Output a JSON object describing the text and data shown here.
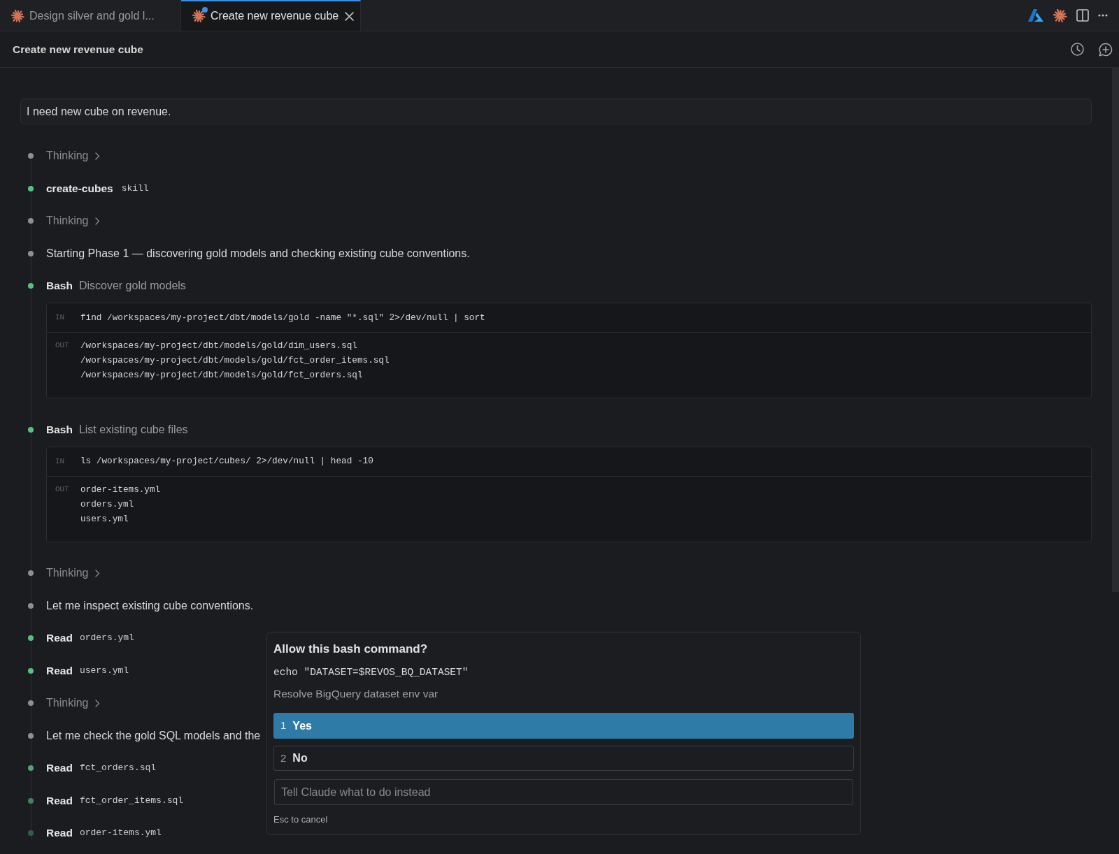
{
  "tabs": [
    {
      "title": "Design silver and gold l...",
      "selected": false,
      "notification": false
    },
    {
      "title": "Create new revenue cube",
      "selected": true,
      "notification": true
    }
  ],
  "header": {
    "title": "Create new revenue cube"
  },
  "user_message": "I need new cube on revenue.",
  "timeline": [
    {
      "kind": "thinking",
      "label": "Thinking",
      "expanded": false,
      "color": "#8e8f92"
    },
    {
      "kind": "skill",
      "name": "create-cubes",
      "tag": "skill",
      "color": "#55c283"
    },
    {
      "kind": "thinking",
      "label": "Thinking",
      "expanded": false,
      "color": "#8e8f92"
    },
    {
      "kind": "message",
      "text": "Starting Phase 1 — discovering gold models and checking existing cube conventions.",
      "color": "#8e8f92"
    },
    {
      "kind": "tool",
      "name": "Bash",
      "description": "Discover gold models",
      "color": "#55c283",
      "io": {
        "in_label": "IN",
        "command": "find /workspaces/my-project/dbt/models/gold -name \"*.sql\" 2>/dev/null | sort",
        "out_label": "OUT",
        "output": [
          "/workspaces/my-project/dbt/models/gold/dim_users.sql",
          "/workspaces/my-project/dbt/models/gold/fct_order_items.sql",
          "/workspaces/my-project/dbt/models/gold/fct_orders.sql"
        ]
      }
    },
    {
      "kind": "tool",
      "name": "Bash",
      "description": "List existing cube files",
      "color": "#55c283",
      "io": {
        "in_label": "IN",
        "command": "ls /workspaces/my-project/cubes/ 2>/dev/null | head -10",
        "out_label": "OUT",
        "output": [
          "order-items.yml",
          "orders.yml",
          "users.yml"
        ]
      }
    },
    {
      "kind": "thinking",
      "label": "Thinking",
      "expanded": false,
      "color": "#8e8f92"
    },
    {
      "kind": "message",
      "text": "Let me inspect existing cube conventions.",
      "color": "#8e8f92"
    },
    {
      "kind": "tool",
      "name": "Read",
      "file": "orders.yml",
      "color": "#55c283"
    },
    {
      "kind": "tool",
      "name": "Read",
      "file": "users.yml",
      "color": "#55c283"
    },
    {
      "kind": "thinking",
      "label": "Thinking",
      "expanded": false,
      "color": "#8e8f92"
    },
    {
      "kind": "message",
      "text": "Let me check the gold SQL models and the",
      "color": "#8e8f92"
    },
    {
      "kind": "tool",
      "name": "Read",
      "file": "fct_orders.sql",
      "color": "#4ca773"
    },
    {
      "kind": "tool",
      "name": "Read",
      "file": "fct_order_items.sql",
      "color": "#3f835d"
    },
    {
      "kind": "tool",
      "name": "Read",
      "file": "order-items.yml",
      "color": "#325e47"
    }
  ],
  "dialog": {
    "title": "Allow this bash command?",
    "command": "echo \"DATASET=$REVOS_BQ_DATASET\"",
    "description": "Resolve BigQuery dataset env var",
    "options": [
      {
        "number": "1",
        "label": "Yes",
        "selected": true
      },
      {
        "number": "2",
        "label": "No",
        "selected": false
      }
    ],
    "input": {
      "placeholder": "Tell Claude what to do instead"
    },
    "hint": "Esc to cancel"
  }
}
